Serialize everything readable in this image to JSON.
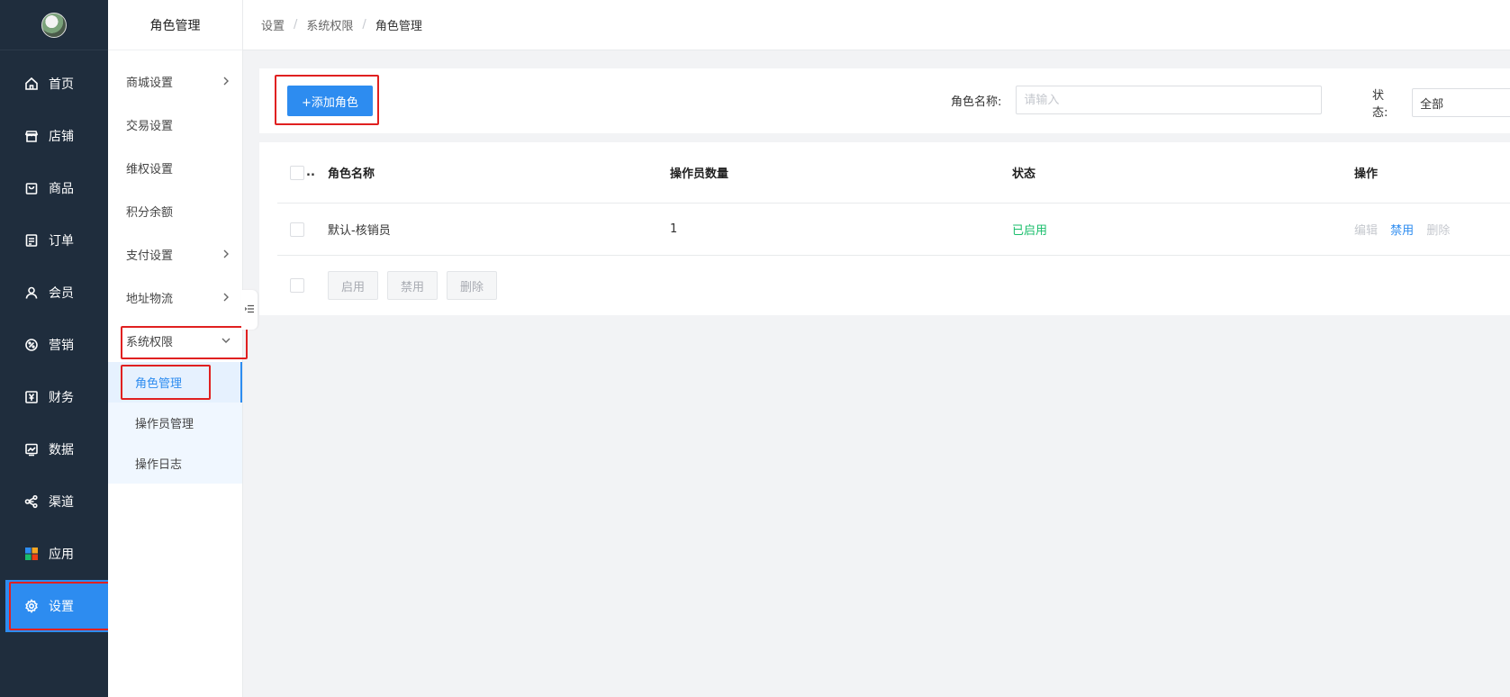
{
  "nav": {
    "items": [
      {
        "label": "首页",
        "icon": "home-icon"
      },
      {
        "label": "店铺",
        "icon": "store-icon"
      },
      {
        "label": "商品",
        "icon": "bag-icon"
      },
      {
        "label": "订单",
        "icon": "order-icon"
      },
      {
        "label": "会员",
        "icon": "user-icon"
      },
      {
        "label": "营销",
        "icon": "marketing-icon"
      },
      {
        "label": "财务",
        "icon": "yen-icon"
      },
      {
        "label": "数据",
        "icon": "chart-icon"
      },
      {
        "label": "渠道",
        "icon": "share-icon"
      },
      {
        "label": "应用",
        "icon": "apps-icon"
      },
      {
        "label": "设置",
        "icon": "gear-icon"
      }
    ],
    "active_index": 10,
    "accent": "#2d8cf0"
  },
  "sub": {
    "title": "角色管理",
    "items": [
      {
        "label": "商城设置",
        "arrow": "right"
      },
      {
        "label": "交易设置",
        "arrow": ""
      },
      {
        "label": "维权设置",
        "arrow": ""
      },
      {
        "label": "积分余额",
        "arrow": ""
      },
      {
        "label": "支付设置",
        "arrow": "right"
      },
      {
        "label": "地址物流",
        "arrow": "right"
      },
      {
        "label": "系统权限",
        "arrow": "down"
      }
    ],
    "children": [
      {
        "label": "角色管理"
      },
      {
        "label": "操作员管理"
      },
      {
        "label": "操作日志"
      }
    ]
  },
  "breadcrumb": [
    "设置",
    "系统权限",
    "角色管理"
  ],
  "toolbar": {
    "add_label": "+添加角色",
    "name_label": "角色名称:",
    "name_placeholder": "请输入",
    "status_label": "状态:",
    "status_value": "全部"
  },
  "table": {
    "header_check_suffix": "..",
    "columns": [
      "角色名称",
      "操作员数量",
      "状态",
      "操作"
    ],
    "rows": [
      {
        "name": "默认-核销员",
        "count": "1",
        "status": "已启用",
        "ops": [
          "编辑",
          "禁用",
          "删除"
        ]
      }
    ],
    "status_color": "#19be6b",
    "batch": [
      "启用",
      "禁用",
      "删除"
    ]
  }
}
